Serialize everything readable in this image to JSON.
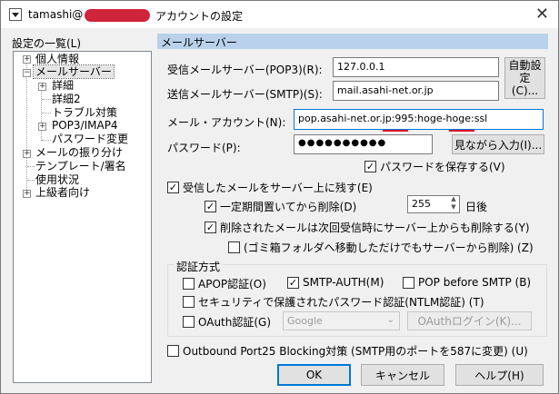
{
  "window": {
    "user": "tamashi@",
    "title": "アカウントの設定",
    "close_glyph": "✕"
  },
  "tree": {
    "heading": "設定の一覧(L)",
    "items": [
      {
        "label": "個人情報"
      },
      {
        "label": "メールサーバー"
      },
      {
        "label": "詳細"
      },
      {
        "label": "詳細2"
      },
      {
        "label": "トラブル対策"
      },
      {
        "label": "POP3/IMAP4"
      },
      {
        "label": "パスワード変更"
      },
      {
        "label": "メールの振り分け"
      },
      {
        "label": "テンプレート/署名"
      },
      {
        "label": "使用状況"
      },
      {
        "label": "上級者向け"
      }
    ]
  },
  "mail_server": {
    "section_title": "メールサーバー",
    "pop3_label": "受信メールサーバー(POP3)(R):",
    "pop3_value": "127.0.0.1",
    "smtp_label": "送信メールサーバー(SMTP)(S):",
    "smtp_value": "mail.asahi-net.or.jp",
    "auto_button": "自動設定(C)...",
    "account_label": "メール・アカウント(N):",
    "account_value": "pop.asahi-net.or.jp:995:hoge-hoge:ssl",
    "password_label": "パスワード(P):",
    "password_value": "●●●●●●●●●●",
    "reveal_button": "見ながら入力(I)...",
    "save_password": "パスワードを保存する(V)",
    "leave_on_server": "受信したメールをサーバー上に残す(E)",
    "delete_after_days": "一定期間置いてから削除(D)",
    "days_value": "255",
    "days_suffix": "日後",
    "delete_when_deleted": "削除されたメールは次回受信時にサーバー上からも削除する(Y)",
    "delete_trash_only": "(ゴミ箱フォルダへ移動しただけでもサーバーから削除) (Z)"
  },
  "auth": {
    "title": "認証方式",
    "apop": "APOP認証(O)",
    "smtp_auth": "SMTP-AUTH(M)",
    "pop_before_smtp": "POP before SMTP (B)",
    "ntlm": "セキュリティで保護されたパスワード認証(NTLM認証) (T)",
    "oauth": "OAuth認証(G)",
    "oauth_provider": "Google",
    "oauth_login": "OAuthログイン(K)..."
  },
  "outbound25": "Outbound Port25 Blocking対策 (SMTP用のポートを587に変更) (U)",
  "buttons": {
    "ok": "OK",
    "cancel": "キャンセル",
    "help": "ヘルプ(H)"
  },
  "glyphs": {
    "check": "✓",
    "plus": "+",
    "minus": "−",
    "chevron_down": "⌄",
    "spin_up": "▲",
    "spin_down": "▼"
  }
}
